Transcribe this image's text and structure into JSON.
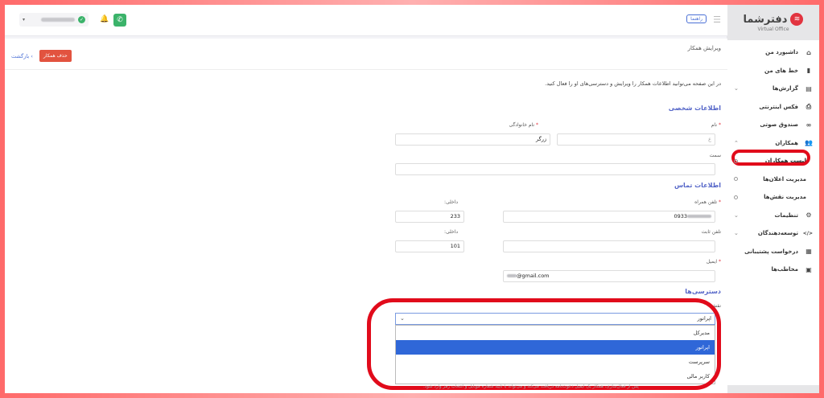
{
  "brand": {
    "name": "دفترشما",
    "subtitle": "Virtual Office"
  },
  "topbar": {
    "help_label": "راهنما",
    "menu_icon": "hamburger-icon",
    "call_icon": "phone-icon",
    "bell_icon": "alarm-icon",
    "status_icon": "check-circle-icon",
    "status_color": "#3bb36a"
  },
  "sidebar": {
    "items": [
      {
        "label": "داشبورد من",
        "icon": "⌂"
      },
      {
        "label": "خط های من",
        "icon": "▮"
      },
      {
        "label": "گزارش‌ها",
        "icon": "▤"
      },
      {
        "label": "فکس اینترنتی",
        "icon": "⎙"
      },
      {
        "label": "صندوق صوتی",
        "icon": "∞"
      },
      {
        "label": "همکاران",
        "icon": "👥"
      },
      {
        "label": "لیست همکاران"
      },
      {
        "label": "مدیریت اعلان‌ها"
      },
      {
        "label": "مدیریت نقش‌ها"
      },
      {
        "label": "تنظیمات",
        "icon": "⚙"
      },
      {
        "label": "توسعه‌دهندگان",
        "icon": "</>"
      },
      {
        "label": "درخواست پشتیبانی",
        "icon": "▦"
      },
      {
        "label": "مخاطب‌ها",
        "icon": "▣"
      }
    ]
  },
  "page": {
    "title": "ویرایش همکار",
    "delete_label": "حذف همکار",
    "back_label": "بازگشت",
    "intro": "در این صفحه می‌توانید اطلاعات همکار را ویرایش و دسترسی‌های او را فعال کنید."
  },
  "personal": {
    "heading": "اطلاعات شخصی",
    "first_name_label": "نام",
    "first_name_value": "ع",
    "last_name_label": "نام خانوادگی",
    "last_name_value": "زرگر",
    "position_label": "سمت",
    "position_value": ""
  },
  "contact": {
    "heading": "اطلاعات تماس",
    "mobile_label": "تلفن همراه",
    "mobile_value": "0933",
    "ext1_label": "داخلی:",
    "ext1_value": "233",
    "landline_label": "تلفن ثابت",
    "landline_value": "",
    "ext2_label": "داخلی:",
    "ext2_value": "101",
    "email_label": "ایمیل",
    "email_value": "@gmail.com"
  },
  "access": {
    "heading": "دسترسی‌ها",
    "role_label": "نقش",
    "role_value": "اپراتور",
    "options": [
      "مدیرکل",
      "اپراتور",
      "سرپرست",
      "کاربر مالی"
    ],
    "footnote": "پس از فعال‌سازی، همکار یک ایمیل دعوت‌نامه دریافت می‌کند و می‌تواند با تایید شماره موبایل و انتخاب رمز وارد شود."
  },
  "colors": {
    "accent": "#5566c8",
    "danger": "#e2533f",
    "highlight_ring": "#e10b1b",
    "selected_option": "#2f67d8"
  }
}
